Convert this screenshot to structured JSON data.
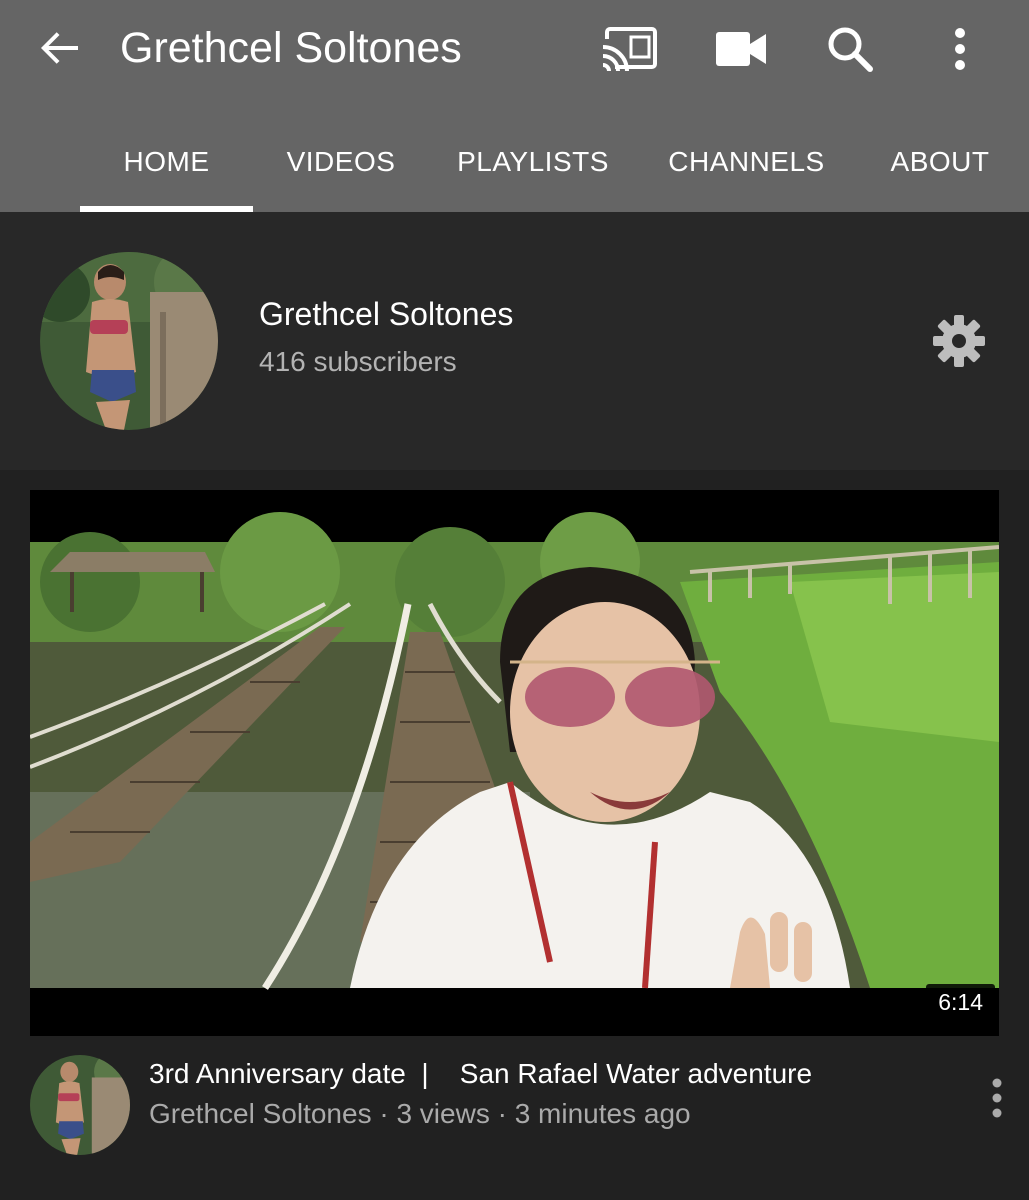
{
  "app_bar": {
    "title": "Grethcel Soltones",
    "icons": [
      "back-arrow-icon",
      "cast-icon",
      "video-camera-icon",
      "search-icon",
      "more-vertical-icon"
    ],
    "background": "#656565"
  },
  "tabs": [
    {
      "label": "HOME",
      "selected": true
    },
    {
      "label": "VIDEOS",
      "selected": false
    },
    {
      "label": "PLAYLISTS",
      "selected": false
    },
    {
      "label": "CHANNELS",
      "selected": false
    },
    {
      "label": "ABOUT",
      "selected": false
    }
  ],
  "channel": {
    "name": "Grethcel Soltones",
    "subscribers": "416 subscribers",
    "settings_icon": "gear-icon"
  },
  "featured_video": {
    "duration": "6:14",
    "title": "3rd Anniversary date  |    San Rafael Water adventure",
    "meta": "Grethcel Soltones · 3 views · 3 minutes ago"
  },
  "colors": {
    "header_bg": "#282828",
    "content_bg": "#212121",
    "secondary_text": "#aaaaaa"
  }
}
